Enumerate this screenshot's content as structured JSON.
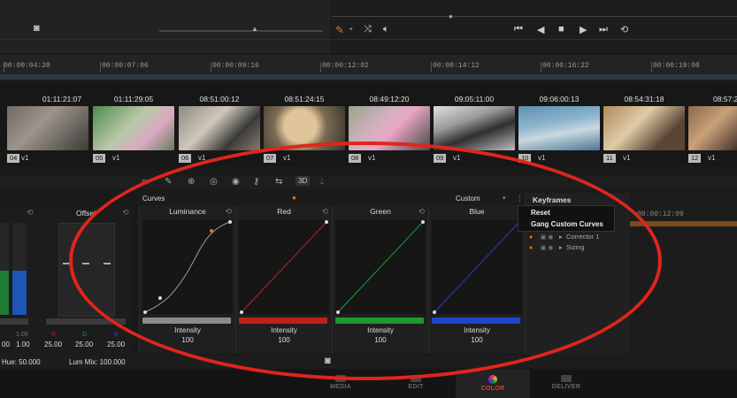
{
  "ruler": {
    "timecodes": [
      "00:00:04:20",
      "00:00:07:06",
      "00:00:09:16",
      "00:00:12:02",
      "00:00:14:12",
      "00:00:16:22",
      "00:00:19:08"
    ]
  },
  "clips": [
    {
      "timecode": "",
      "num": "04",
      "track": "v1"
    },
    {
      "timecode": "01:11:29:05",
      "num": "05",
      "track": "v1"
    },
    {
      "timecode": "08:51:00:12",
      "num": "06",
      "track": "v1"
    },
    {
      "timecode": "08:51:24:15",
      "num": "07",
      "track": "v1"
    },
    {
      "timecode": "08:49:12:20",
      "num": "08",
      "track": "v1"
    },
    {
      "timecode": "09:05:11:00",
      "num": "09",
      "track": "v1"
    },
    {
      "timecode": "09:06:00:13",
      "num": "10",
      "track": "v1"
    },
    {
      "timecode": "08:54:31:18",
      "num": "11",
      "track": "v1"
    },
    {
      "timecode": "08:57:2",
      "num": "12",
      "track": "v1"
    }
  ],
  "first_clip_timecode": "01:11:21:07",
  "toolbar": {
    "threed_label": "3D"
  },
  "curves": {
    "panel_title": "Curves",
    "mode": "Custom",
    "columns": [
      {
        "title": "Luminance",
        "intensity_label": "Intensity",
        "intensity_value": "100",
        "color": "#8a8a8a"
      },
      {
        "title": "Red",
        "intensity_label": "Intensity",
        "intensity_value": "100",
        "color": "#c0201a"
      },
      {
        "title": "Green",
        "intensity_label": "Intensity",
        "intensity_value": "100",
        "color": "#1d9a2a"
      },
      {
        "title": "Blue",
        "intensity_label": "Intensity",
        "intensity_value": "100",
        "color": "#1f45c8"
      }
    ]
  },
  "offset": {
    "title": "Offset",
    "values_row1": [
      "1.00",
      "1.00"
    ],
    "channel_labels": [
      "R",
      "G",
      "B"
    ],
    "channel_values": [
      "25.00",
      "25.00",
      "25.00"
    ],
    "leading_value": "00"
  },
  "keyframes": {
    "title": "Keyframes",
    "menu": [
      "Reset",
      "Gang Custom Curves"
    ],
    "tracks": [
      "Corrector 1",
      "Sizing"
    ],
    "timecode": "00:00:12:09"
  },
  "info": {
    "hue": "Hue: 50.000",
    "lum_mix": "Lum Mix: 100.000"
  },
  "nav_tabs": [
    {
      "label": "MEDIA",
      "active": false
    },
    {
      "label": "EDIT",
      "active": false
    },
    {
      "label": "COLOR",
      "active": true
    },
    {
      "label": "DELIVER",
      "active": false
    }
  ],
  "colors": {
    "accent": "#e23b3b",
    "annotation": "#e0251b",
    "orange": "#e2761b"
  }
}
